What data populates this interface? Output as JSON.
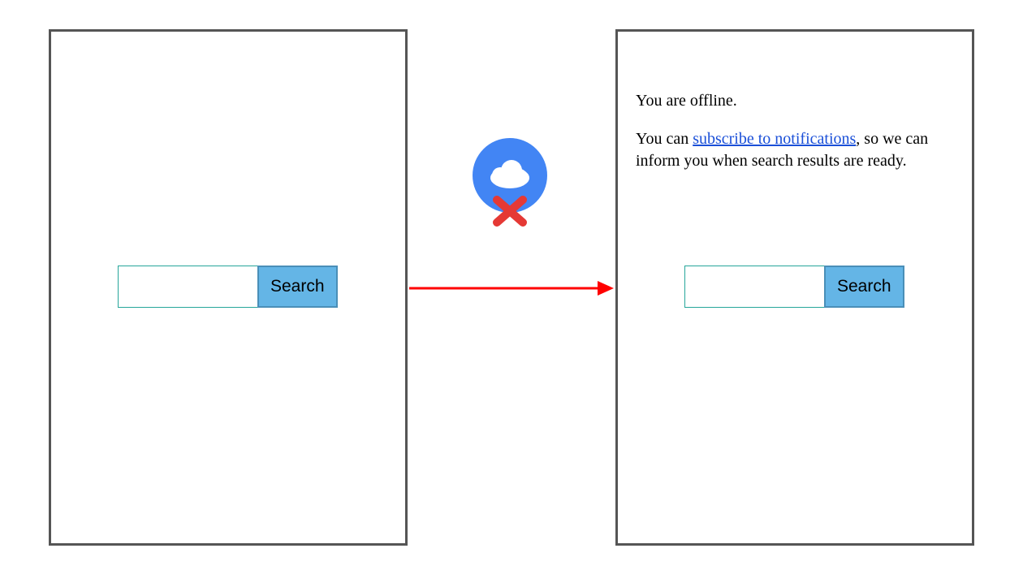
{
  "left": {
    "search_input_value": "",
    "search_button_label": "Search"
  },
  "right": {
    "offline_text": "You are offline.",
    "notify_prefix": "You can ",
    "notify_link": "subscribe to notifications",
    "notify_suffix": ", so we can inform you when search results are ready.",
    "search_input_value": "",
    "search_button_label": "Search"
  },
  "icons": {
    "offline_cloud": "cloud-offline-icon",
    "transition_arrow": "arrow-right-icon"
  }
}
